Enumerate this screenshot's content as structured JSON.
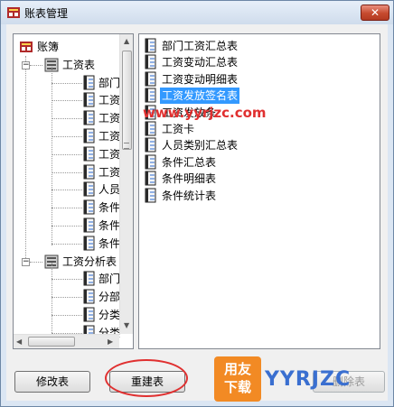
{
  "window": {
    "title": "账表管理",
    "close_glyph": "✕"
  },
  "tree": {
    "root_label": "账簿",
    "nodes": [
      {
        "label": "工资表",
        "expander": "−",
        "children": [
          "部门",
          "工资",
          "工资",
          "工资",
          "工资",
          "工资",
          "人员",
          "条件",
          "条件",
          "条件"
        ]
      },
      {
        "label": "工资分析表",
        "expander": "−",
        "children": [
          "部门",
          "分部",
          "分类",
          "分类"
        ]
      }
    ]
  },
  "list": {
    "items": [
      {
        "label": "部门工资汇总表",
        "selected": false
      },
      {
        "label": "工资变动汇总表",
        "selected": false
      },
      {
        "label": "工资变动明细表",
        "selected": false
      },
      {
        "label": "工资发放签名表",
        "selected": true
      },
      {
        "label": "工资发放条",
        "selected": false
      },
      {
        "label": "工资卡",
        "selected": false
      },
      {
        "label": "人员类别汇总表",
        "selected": false
      },
      {
        "label": "条件汇总表",
        "selected": false
      },
      {
        "label": "条件明细表",
        "selected": false
      },
      {
        "label": "条件统计表",
        "selected": false
      }
    ]
  },
  "buttons": {
    "modify": "修改表",
    "rebuild": "重建表",
    "delete_partial": "删除表"
  },
  "watermark": {
    "url": "www.yyrjzc.com",
    "logo_top": "用友",
    "logo_bottom": "下载",
    "brand": "YYRJZC"
  },
  "icons": {
    "app": "account-book-icon",
    "folder": "ledger-book-icon",
    "report": "report-document-icon"
  },
  "colors": {
    "selection": "#3399ff",
    "close": "#c64a2e",
    "annotation": "#e03030",
    "logo": "#f28a24"
  }
}
